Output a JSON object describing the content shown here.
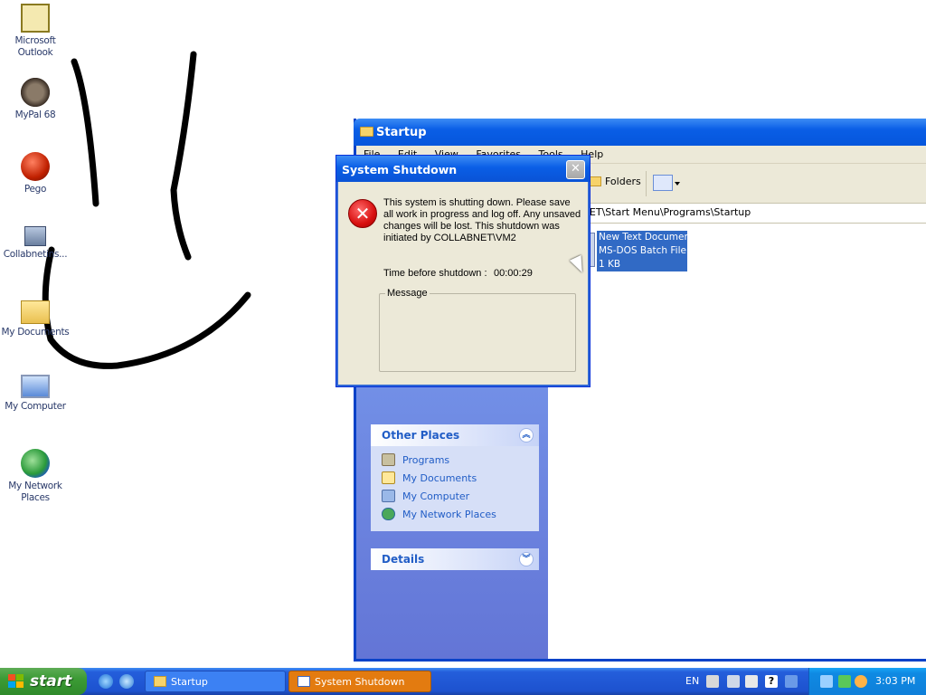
{
  "desktop": {
    "icons": [
      {
        "label": "Microsoft Outlook",
        "icon": "outlook-icon"
      },
      {
        "label": "MyPal 68",
        "icon": "raccoon-icon"
      },
      {
        "label": "Pego",
        "icon": "red-ball-icon"
      },
      {
        "label": "Collabnetins...",
        "icon": "network-computer-icon"
      },
      {
        "label": "My Documents",
        "icon": "documents-folder-icon"
      },
      {
        "label": "My Computer",
        "icon": "computer-icon"
      },
      {
        "label": "My Network Places",
        "icon": "network-places-icon"
      }
    ]
  },
  "explorer": {
    "title": "Startup",
    "menu": [
      "File",
      "Edit",
      "View",
      "Favorites",
      "Tools",
      "Help"
    ],
    "folders_label": "Folders",
    "address": "C:\\Documents and Settings\\All Users.COLLABNET\\Start Menu\\Programs\\Startup",
    "file": {
      "name": "New Text Document",
      "type": "MS-DOS Batch File",
      "size": "1 KB"
    },
    "other_places": {
      "title": "Other Places",
      "links": [
        "Programs",
        "My Documents",
        "My Computer",
        "My Network Places"
      ]
    },
    "details": {
      "title": "Details"
    }
  },
  "dialog": {
    "title": "System Shutdown",
    "message": "This system is shutting down. Please save all work in progress and log off. Any unsaved changes will be lost. This shutdown was initiated by COLLABNET\\VM2",
    "timer_label": "Time before shutdown :",
    "timer_value": "00:00:29",
    "group_label": "Message",
    "close_symbol": "✕"
  },
  "taskbar": {
    "start_label": "start",
    "tasks": [
      {
        "label": "Startup",
        "active": false
      },
      {
        "label": "System Shutdown",
        "active": true
      }
    ],
    "language": "EN",
    "clock": "3:03 PM"
  },
  "colors": {
    "xp_blue": "#0a5ee6",
    "start_green": "#3c9b35",
    "active_task_orange": "#e37b10",
    "link_blue": "#215dc6"
  }
}
